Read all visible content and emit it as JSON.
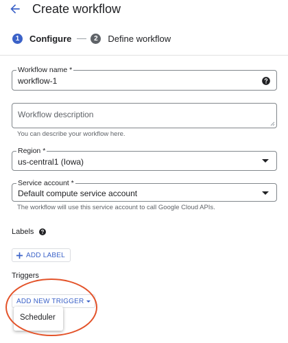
{
  "header": {
    "title": "Create workflow",
    "back_icon": "arrow-back-icon"
  },
  "stepper": {
    "steps": [
      {
        "number": "1",
        "label": "Configure",
        "state": "active"
      },
      {
        "number": "2",
        "label": "Define workflow",
        "state": "inactive"
      }
    ]
  },
  "form": {
    "workflow_name": {
      "label": "Workflow name *",
      "value": "workflow-1"
    },
    "workflow_description": {
      "placeholder": "Workflow description",
      "hint": "You can describe your workflow here."
    },
    "region": {
      "label": "Region *",
      "value": "us-central1 (Iowa)"
    },
    "service_account": {
      "label": "Service account *",
      "value": "Default compute service account",
      "hint": "The workflow will use this service account to call Google Cloud APIs."
    }
  },
  "labels": {
    "title": "Labels",
    "add_button": "ADD LABEL"
  },
  "triggers": {
    "title": "Triggers",
    "add_button": "ADD NEW TRIGGER",
    "menu_items": [
      "Scheduler"
    ]
  },
  "colors": {
    "accent": "#3b62c8",
    "highlight": "#e3532a",
    "step_inactive": "#5f6368"
  }
}
